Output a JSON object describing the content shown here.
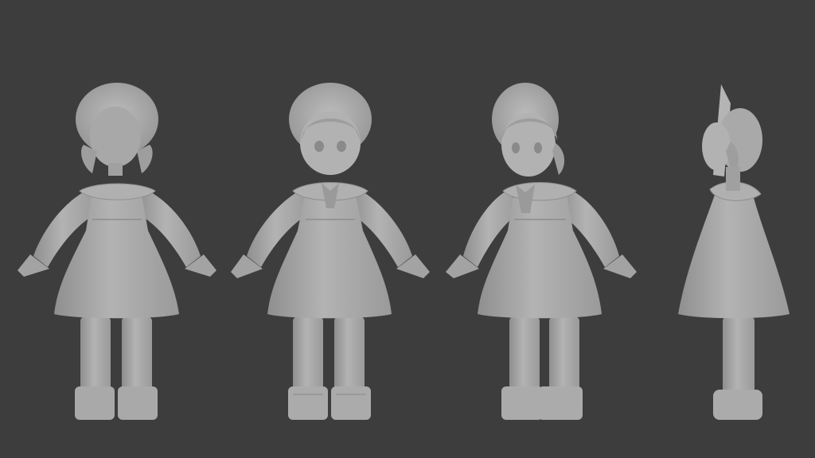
{
  "scene": {
    "background": "#3d3d3d",
    "clay_color": "#a6a6a6",
    "clay_light": "#b8b8b8",
    "clay_dark": "#8a8a8a",
    "views": [
      {
        "name": "back-view"
      },
      {
        "name": "front-view"
      },
      {
        "name": "three-quarter-view"
      },
      {
        "name": "side-view"
      }
    ]
  }
}
